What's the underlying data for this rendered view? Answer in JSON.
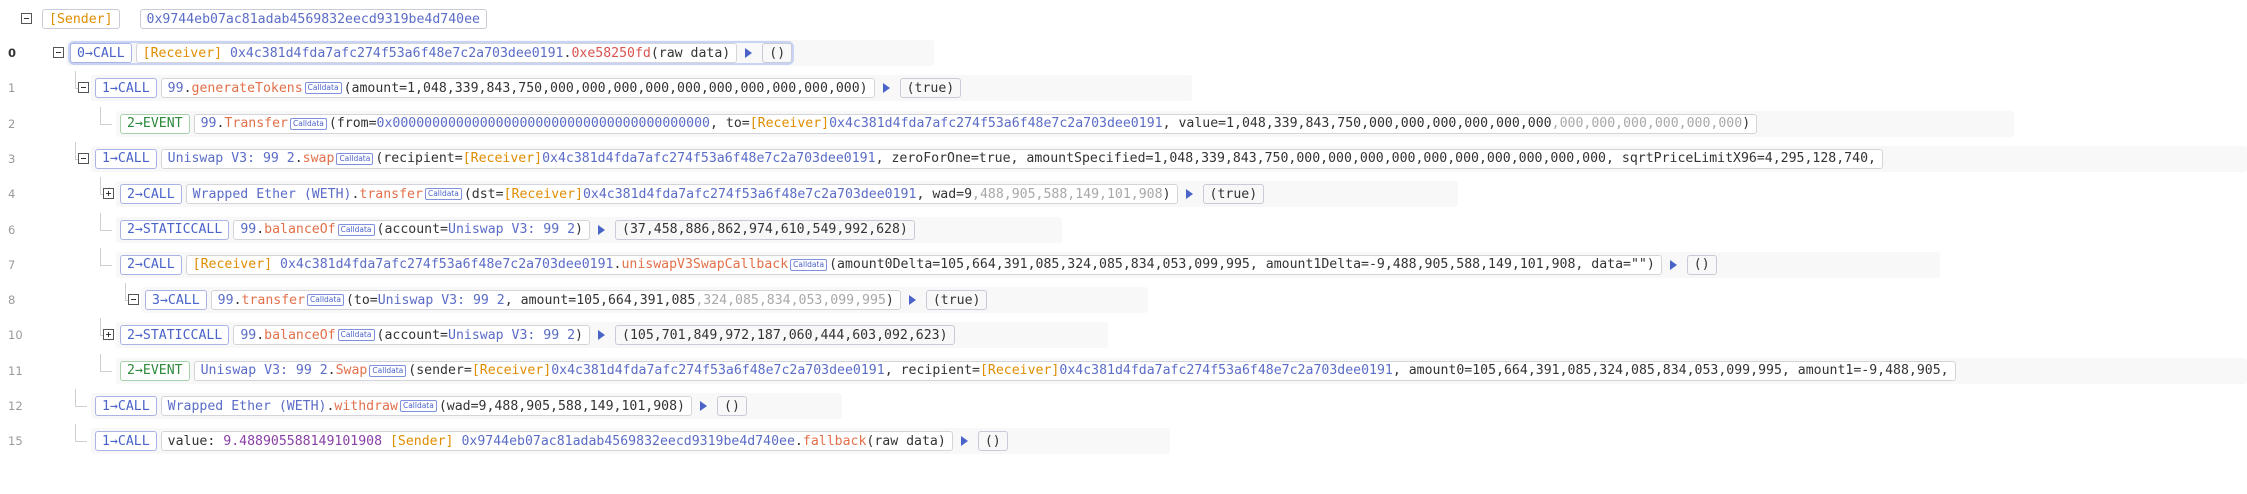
{
  "header": {
    "sender_label": "[Sender]",
    "sender_address": "0x9744eb07ac81adab4569832eecd9319be4d740ee"
  },
  "rows": [
    {
      "line": "0",
      "depth": "0",
      "kind": "CALL",
      "parts": [
        [
          "recv",
          "[Receiver] "
        ],
        [
          "addr",
          "0x4c381d4fda7afc274f53a6f48e7c2a703dee0191"
        ],
        [
          "val",
          "."
        ],
        [
          "fn red",
          "0xe58250fd"
        ],
        [
          "val",
          "(raw data)"
        ]
      ],
      "ret": "()"
    },
    {
      "line": "1",
      "depth": "1",
      "kind": "CALL",
      "parts": [
        [
          "contract",
          "99"
        ],
        [
          "val",
          "."
        ],
        [
          "fn",
          "generateTokens"
        ],
        [
          "cd",
          ""
        ],
        [
          "val",
          "(amount=1,048,339,843,750,000,000,000,000,000,000,000,000,000,000)"
        ]
      ],
      "ret": "(true)"
    },
    {
      "line": "2",
      "depth": "2",
      "kind": "EVENT",
      "parts": [
        [
          "contract",
          "99"
        ],
        [
          "val",
          "."
        ],
        [
          "fn",
          "Transfer"
        ],
        [
          "cd",
          ""
        ],
        [
          "val",
          "(from="
        ],
        [
          "addr",
          "0x0000000000000000000000000000000000000000"
        ],
        [
          "val",
          ", to="
        ],
        [
          "recv",
          "[Receiver]"
        ],
        [
          "addr",
          "0x4c381d4fda7afc274f53a6f48e7c2a703dee0191"
        ],
        [
          "val",
          ", value=1,048,339,843,750,000,000,000,000,000,000"
        ],
        [
          "dim",
          ",000,000,000,000,000,000"
        ],
        [
          "val",
          ")"
        ]
      ],
      "ret": ""
    },
    {
      "line": "3",
      "depth": "1",
      "kind": "CALL",
      "parts": [
        [
          "contract",
          "Uniswap V3: 99 2"
        ],
        [
          "val",
          "."
        ],
        [
          "fn",
          "swap"
        ],
        [
          "cd",
          ""
        ],
        [
          "val",
          "(recipient="
        ],
        [
          "recv",
          "[Receiver]"
        ],
        [
          "addr",
          "0x4c381d4fda7afc274f53a6f48e7c2a703dee0191"
        ],
        [
          "val",
          ", zeroForOne=true, amountSpecified=1,048,339,843,750,000,000,000,000,000,000,000,000,000,000, sqrtPriceLimitX96=4,295,128,740,"
        ]
      ],
      "ret": ""
    },
    {
      "line": "4",
      "depth": "2",
      "kind": "CALL",
      "parts": [
        [
          "contract",
          "Wrapped Ether (WETH)"
        ],
        [
          "val",
          "."
        ],
        [
          "fn",
          "transfer"
        ],
        [
          "cd",
          ""
        ],
        [
          "val",
          "(dst="
        ],
        [
          "recv",
          "[Receiver]"
        ],
        [
          "addr",
          "0x4c381d4fda7afc274f53a6f48e7c2a703dee0191"
        ],
        [
          "val",
          ", wad=9"
        ],
        [
          "dim",
          ",488,905,588,149,101,908"
        ],
        [
          "val",
          ")"
        ]
      ],
      "ret": "(true)"
    },
    {
      "line": "6",
      "depth": "2",
      "kind": "STATICCALL",
      "parts": [
        [
          "contract",
          "99"
        ],
        [
          "val",
          "."
        ],
        [
          "fn",
          "balanceOf"
        ],
        [
          "cd",
          ""
        ],
        [
          "val",
          "(account="
        ],
        [
          "contract",
          "Uniswap V3: 99 2"
        ],
        [
          "val",
          ")"
        ]
      ],
      "ret": "(37,458,886,862,974,610,549,992,628)"
    },
    {
      "line": "7",
      "depth": "2",
      "kind": "CALL",
      "parts": [
        [
          "recv",
          "[Receiver] "
        ],
        [
          "addr",
          "0x4c381d4fda7afc274f53a6f48e7c2a703dee0191"
        ],
        [
          "val",
          "."
        ],
        [
          "fn",
          "uniswapV3SwapCallback"
        ],
        [
          "cd",
          ""
        ],
        [
          "val",
          "(amount0Delta=105,664,391,085,324,085,834,053,099,995, amount1Delta=-9,488,905,588,149,101,908, data=\"\")"
        ]
      ],
      "ret": "()"
    },
    {
      "line": "8",
      "depth": "3",
      "kind": "CALL",
      "parts": [
        [
          "contract",
          "99"
        ],
        [
          "val",
          "."
        ],
        [
          "fn",
          "transfer"
        ],
        [
          "cd",
          ""
        ],
        [
          "val",
          "(to="
        ],
        [
          "contract",
          "Uniswap V3: 99 2"
        ],
        [
          "val",
          ", amount=105,664,391,085"
        ],
        [
          "dim",
          ",324,085,834,053,099,995"
        ],
        [
          "val",
          ")"
        ]
      ],
      "ret": "(true)"
    },
    {
      "line": "10",
      "depth": "2",
      "kind": "STATICCALL",
      "parts": [
        [
          "contract",
          "99"
        ],
        [
          "val",
          "."
        ],
        [
          "fn",
          "balanceOf"
        ],
        [
          "cd",
          ""
        ],
        [
          "val",
          "(account="
        ],
        [
          "contract",
          "Uniswap V3: 99 2"
        ],
        [
          "val",
          ")"
        ]
      ],
      "ret": "(105,701,849,972,187,060,444,603,092,623)"
    },
    {
      "line": "11",
      "depth": "2",
      "kind": "EVENT",
      "parts": [
        [
          "contract",
          "Uniswap V3: 99 2"
        ],
        [
          "val",
          "."
        ],
        [
          "fn",
          "Swap"
        ],
        [
          "cd",
          ""
        ],
        [
          "val",
          "(sender="
        ],
        [
          "recv",
          "[Receiver]"
        ],
        [
          "addr",
          "0x4c381d4fda7afc274f53a6f48e7c2a703dee0191"
        ],
        [
          "val",
          ", recipient="
        ],
        [
          "recv",
          "[Receiver]"
        ],
        [
          "addr",
          "0x4c381d4fda7afc274f53a6f48e7c2a703dee0191"
        ],
        [
          "val",
          ", amount0=105,664,391,085,324,085,834,053,099,995, amount1=-9,488,905,"
        ]
      ],
      "ret": ""
    },
    {
      "line": "12",
      "depth": "1",
      "kind": "CALL",
      "parts": [
        [
          "contract",
          "Wrapped Ether (WETH)"
        ],
        [
          "val",
          "."
        ],
        [
          "fn",
          "withdraw"
        ],
        [
          "cd",
          ""
        ],
        [
          "val",
          "(wad=9,488,905,588,149,101,908)"
        ]
      ],
      "ret": "()"
    },
    {
      "line": "15",
      "depth": "1",
      "kind": "CALL",
      "parts": [
        [
          "val",
          "value: "
        ],
        [
          "purple",
          "9.488905588149101908 "
        ],
        [
          "sender",
          "[Sender] "
        ],
        [
          "addr",
          "0x9744eb07ac81adab4569832eecd9319be4d740ee"
        ],
        [
          "val",
          "."
        ],
        [
          "fn",
          "fallback"
        ],
        [
          "val",
          "(raw data)"
        ]
      ],
      "ret": "()"
    }
  ],
  "calldata_label": "Calldata",
  "arrow": "→"
}
